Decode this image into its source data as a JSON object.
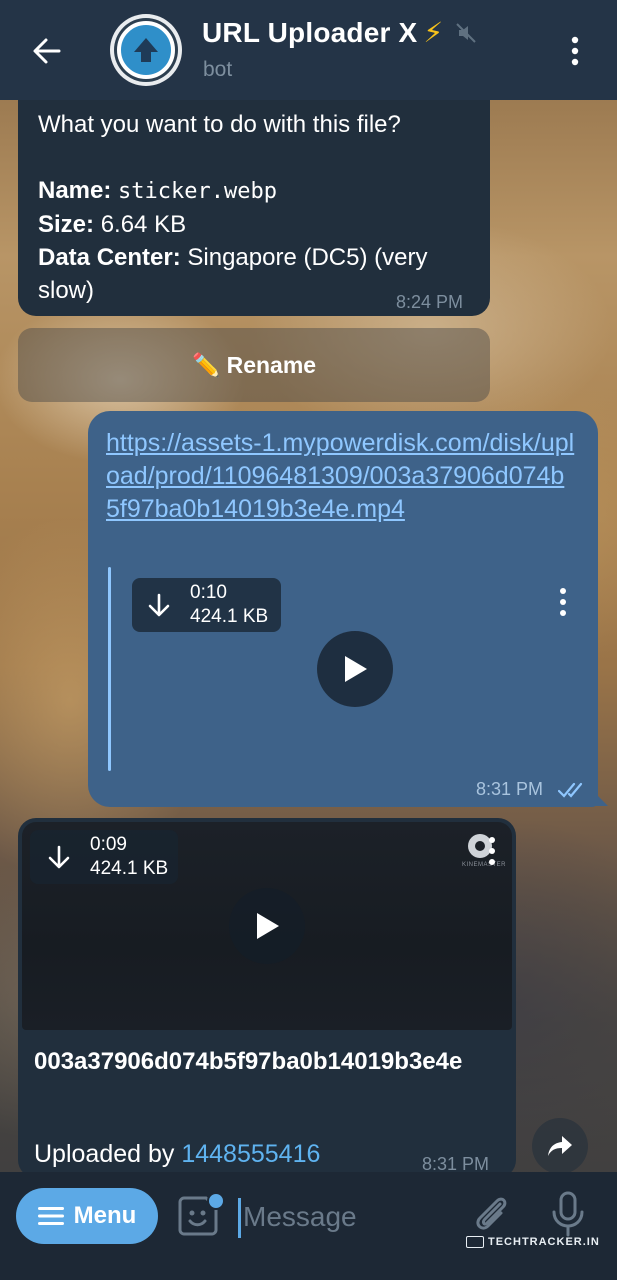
{
  "header": {
    "title": "URL Uploader X",
    "title_emoji": "⚡",
    "subtitle": "bot",
    "icons": [
      "back-arrow-icon",
      "muted-icon",
      "more-vert-icon"
    ]
  },
  "messages": {
    "file_info": {
      "question": "What you want to do with this file?",
      "name_label": "Name:",
      "name_value": "sticker.webp",
      "size_label": "Size:",
      "size_value": "6.64 KB",
      "dc_label": "Data Center:",
      "dc_value": "Singapore (DC5) (very slow)",
      "time": "8:24 PM"
    },
    "rename_button": {
      "emoji": "✏️",
      "label": "Rename"
    },
    "outgoing_link": {
      "url": "https://assets-1.mypowerdisk.com/disk/upload/prod/11096481309/003a37906d074b5f97ba0b14019b3e4e.mp4",
      "video_duration": "0:10",
      "video_size": "424.1 KB",
      "time": "8:31 PM",
      "read_status": "double-check-icon"
    },
    "uploaded_video": {
      "duration": "0:09",
      "size": "424.1 KB",
      "title": "003a37906d074b5f97ba0b14019b3e4e",
      "uploaded_by_label": "Uploaded by",
      "uploader_id": "1448555416",
      "time": "8:31 PM",
      "watermark_text": "KINEMASTER"
    }
  },
  "input_bar": {
    "menu_label": "Menu",
    "message_placeholder": "Message",
    "icons": [
      "sticker-icon",
      "attach-icon",
      "mic-icon"
    ]
  },
  "watermark": {
    "text": "TECHTRACKER.IN"
  },
  "colors": {
    "header_bg": "#243447",
    "incoming_bubble": "#212f3d",
    "outgoing_bubble": "#3e6289",
    "link": "#8fc7ff",
    "accent": "#5ca9e6",
    "muted_text": "#7d8e9e"
  }
}
